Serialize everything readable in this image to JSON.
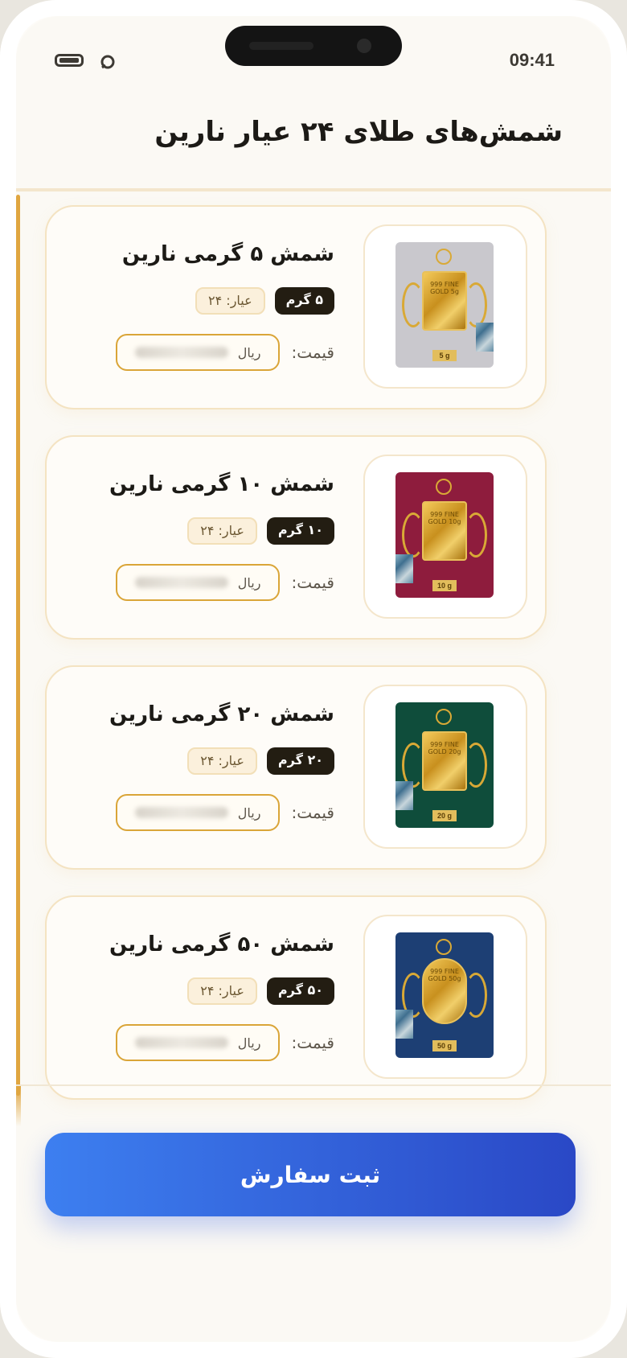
{
  "status": {
    "time": "09:41"
  },
  "header": {
    "title": "شمش‌های طلای ۲۴ عیار نارین"
  },
  "colors": {
    "accent": "#e0a640",
    "button_start": "#3d7ff0",
    "button_end": "#2a48c6"
  },
  "products": [
    {
      "name": "شمش ۵ گرمی نارین",
      "weight": "۵ گرم",
      "karat": "عیار: ۲۴",
      "price_label": "قیمت:",
      "price_unit": "ریال",
      "card_color": "#c9c8cd",
      "bar_label": "5 g",
      "bar_text": "999 FINE GOLD 5g"
    },
    {
      "name": "شمش ۱۰ گرمی نارین",
      "weight": "۱۰ گرم",
      "karat": "عیار: ۲۴",
      "price_label": "قیمت:",
      "price_unit": "ریال",
      "card_color": "#8e1c3d",
      "bar_label": "10 g",
      "bar_text": "999 FINE GOLD 10g"
    },
    {
      "name": "شمش ۲۰ گرمی نارین",
      "weight": "۲۰ گرم",
      "karat": "عیار: ۲۴",
      "price_label": "قیمت:",
      "price_unit": "ریال",
      "card_color": "#0f4d3b",
      "bar_label": "20 g",
      "bar_text": "999 FINE GOLD 20g"
    },
    {
      "name": "شمش ۵۰ گرمی نارین",
      "weight": "۵۰ گرم",
      "karat": "عیار: ۲۴",
      "price_label": "قیمت:",
      "price_unit": "ریال",
      "card_color": "#1d3f74",
      "bar_label": "50 g",
      "bar_text": "999 FINE GOLD 50g"
    }
  ],
  "order_button": {
    "label": "ثبت سفارش"
  }
}
